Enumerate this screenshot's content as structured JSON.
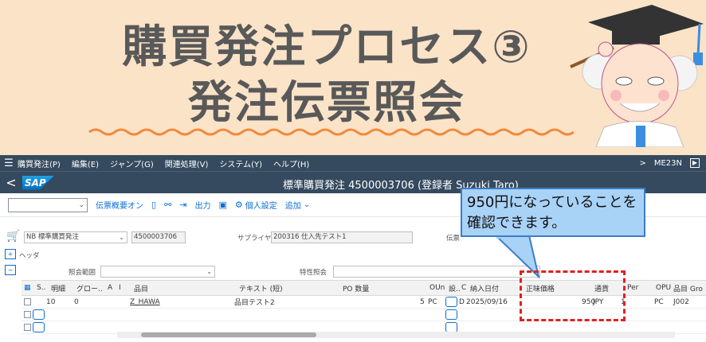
{
  "banner": {
    "title_line1": "購買発注プロセス③",
    "title_line2": "発注伝票照会"
  },
  "menubar": {
    "items": [
      "購買発注(P)",
      "編集(E)",
      "ジャンプ(G)",
      "関連処理(V)",
      "システム(Y)",
      "ヘルプ(H)"
    ],
    "tcode": "ME23N"
  },
  "titlebar": {
    "logo": "SAP",
    "title": "標準購買発注 4500003706 (登録者 Suzuki Taro)"
  },
  "toolbar": {
    "select_value": "",
    "items": [
      "伝票概要オン",
      "",
      "",
      "",
      "出力",
      "",
      "個人設定",
      "追加"
    ]
  },
  "header": {
    "doc_type": "NB 標準購買発注",
    "po_number": "4500003706",
    "supplier_label": "サプライヤ:",
    "supplier_value": "200316 仕入先テスト1",
    "doc_date_label": "伝票",
    "header_label": "ヘッダ",
    "ref_range_label": "照会範囲",
    "char_label": "特性照会"
  },
  "grid": {
    "columns": [
      "S..",
      "明細",
      "グロー..",
      "A",
      "I",
      "品目",
      "テキスト (短)",
      "PO 数量",
      "OUn",
      "設..",
      "C",
      "納入日付",
      "正味価格",
      "通貨",
      "Per",
      "OPU",
      "品目 Gro"
    ],
    "rows": [
      {
        "item": "10",
        "group": "0",
        "material": "Z_HAWA",
        "text": "品目テスト2",
        "qty": "5",
        "oun": "PC",
        "c": "D",
        "date": "2025/09/16",
        "price": "950",
        "currency": "JPY",
        "per": "1",
        "opu": "PC",
        "mgroup": "J002"
      }
    ]
  },
  "callout": {
    "text": "950円になっていることを確認できます。"
  },
  "colors": {
    "shell": "#354a5f",
    "accent": "#0a6ed1",
    "callout": "#a9d2f7",
    "highlight": "#e02020"
  }
}
